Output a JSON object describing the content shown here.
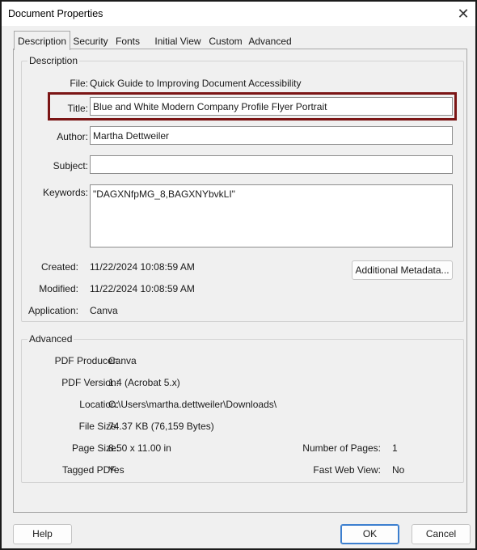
{
  "window": {
    "title": "Document Properties"
  },
  "tabs": [
    {
      "label": "Description"
    },
    {
      "label": "Security"
    },
    {
      "label": "Fonts"
    },
    {
      "label": "Initial View"
    },
    {
      "label": "Custom"
    },
    {
      "label": "Advanced"
    }
  ],
  "description": {
    "group_title": "Description",
    "file_label": "File:",
    "file_value": "Quick Guide to Improving Document Accessibility",
    "title_label": "Title:",
    "title_value": "Blue and White Modern Company Profile Flyer Portrait",
    "author_label": "Author:",
    "author_value": "Martha Dettweiler",
    "subject_label": "Subject:",
    "subject_value": "",
    "keywords_label": "Keywords:",
    "keywords_value": "\"DAGXNfpMG_8,BAGXNYbvkLI\"",
    "created_label": "Created:",
    "created_value": "11/22/2024 10:08:59 AM",
    "modified_label": "Modified:",
    "modified_value": "11/22/2024 10:08:59 AM",
    "application_label": "Application:",
    "application_value": "Canva",
    "additional_metadata_label": "Additional Metadata..."
  },
  "advanced": {
    "group_title": "Advanced",
    "producer_label": "PDF Producer:",
    "producer_value": "Canva",
    "version_label": "PDF Version:",
    "version_value": "1.4 (Acrobat 5.x)",
    "location_label": "Location:",
    "location_value": "C:\\Users\\martha.dettweiler\\Downloads\\",
    "filesize_label": "File Size:",
    "filesize_value": "74.37 KB (76,159 Bytes)",
    "pagesize_label": "Page Size:",
    "pagesize_value": "8.50 x 11.00 in",
    "numpages_label": "Number of Pages:",
    "numpages_value": "1",
    "tagged_label": "Tagged PDF:",
    "tagged_value": "Yes",
    "fastweb_label": "Fast Web View:",
    "fastweb_value": "No"
  },
  "buttons": {
    "help": "Help",
    "ok": "OK",
    "cancel": "Cancel"
  },
  "icons": {
    "close": "close-icon"
  },
  "colors": {
    "highlight_border": "#7b1515",
    "ok_border": "#3c7fcf"
  }
}
